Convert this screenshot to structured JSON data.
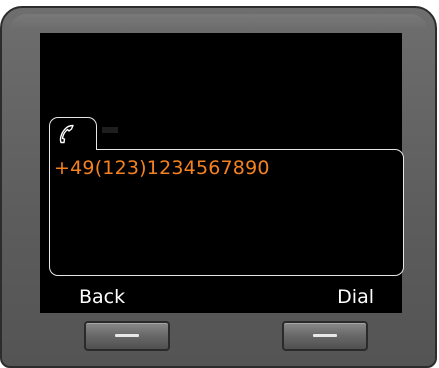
{
  "screen": {
    "tab_icon": "handset-icon",
    "phone_number": "+49(123)1234567890",
    "accent_color": "#f58220"
  },
  "softkeys": {
    "left_label": "Back",
    "right_label": "Dial"
  },
  "hardware_keys": {
    "left": "left-softkey",
    "right": "right-softkey"
  }
}
